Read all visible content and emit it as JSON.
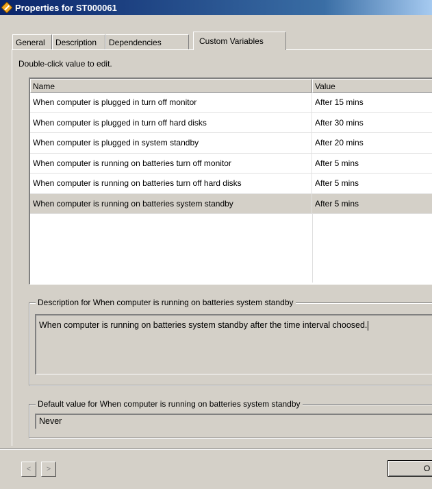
{
  "window": {
    "title": "Properties for ST000061"
  },
  "tabs": [
    {
      "label": "General"
    },
    {
      "label": "Description"
    },
    {
      "label": "Dependencies"
    },
    {
      "label": "Custom Variables",
      "active": true
    }
  ],
  "hint": "Double-click value to edit.",
  "table": {
    "columns": {
      "name": "Name",
      "value": "Value"
    },
    "rows": [
      {
        "name": "When computer is plugged in turn off monitor",
        "value": "After 15 mins"
      },
      {
        "name": "When computer is plugged in turn off hard disks",
        "value": "After 30 mins"
      },
      {
        "name": "When computer is plugged in system standby",
        "value": "After 20 mins"
      },
      {
        "name": "When computer is running on batteries turn off monitor",
        "value": "After 5 mins"
      },
      {
        "name": "When computer is running on batteries turn off hard disks",
        "value": "After 5 mins"
      },
      {
        "name": "When computer is running on batteries system standby",
        "value": "After 5 mins",
        "selected": true
      }
    ]
  },
  "description": {
    "title": "Description for When computer is running on batteries system standby",
    "text": "When computer is running on batteries system standby after the time interval choosed."
  },
  "default_value": {
    "title": "Default value for When computer is running on batteries system standby",
    "value": "Never"
  },
  "buttons": {
    "prev": "<",
    "next": ">",
    "ok": "O"
  },
  "colors": {
    "titlebar_start": "#0a246a",
    "titlebar_end": "#a6caf0",
    "face": "#d4d0c8",
    "selected_row": "#d4d0c8"
  }
}
